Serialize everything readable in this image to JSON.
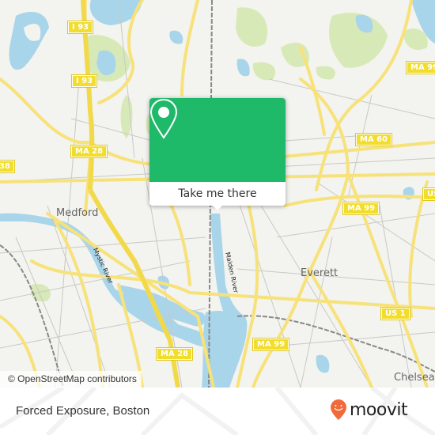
{
  "map": {
    "attribution": "© OpenStreetMap contributors",
    "places": [
      {
        "name": "Medford"
      },
      {
        "name": "Everett"
      },
      {
        "name": "Chelsea"
      }
    ],
    "rivers": [
      {
        "name": "Mystic River"
      },
      {
        "name": "Malden River"
      }
    ],
    "shields": [
      {
        "label": "I 93"
      },
      {
        "label": "I 93"
      },
      {
        "label": "MA 28"
      },
      {
        "label": "38"
      },
      {
        "label": "MA 28"
      },
      {
        "label": "MA 60"
      },
      {
        "label": "MA 99"
      },
      {
        "label": "MA 99"
      },
      {
        "label": "MA 99"
      },
      {
        "label": "US 1"
      },
      {
        "label": "US"
      }
    ],
    "colors": {
      "background": "#f3f3ef",
      "water": "#a9d5ea",
      "park": "#d8e9b8",
      "road": "#f7e27a",
      "shield": "#f2dd2c"
    }
  },
  "popup": {
    "action_label": "Take me there",
    "accent": "#1fb96a"
  },
  "footer": {
    "title": "Forced Exposure, Boston",
    "brand": "moovit",
    "brand_color": "#f06a3a"
  }
}
